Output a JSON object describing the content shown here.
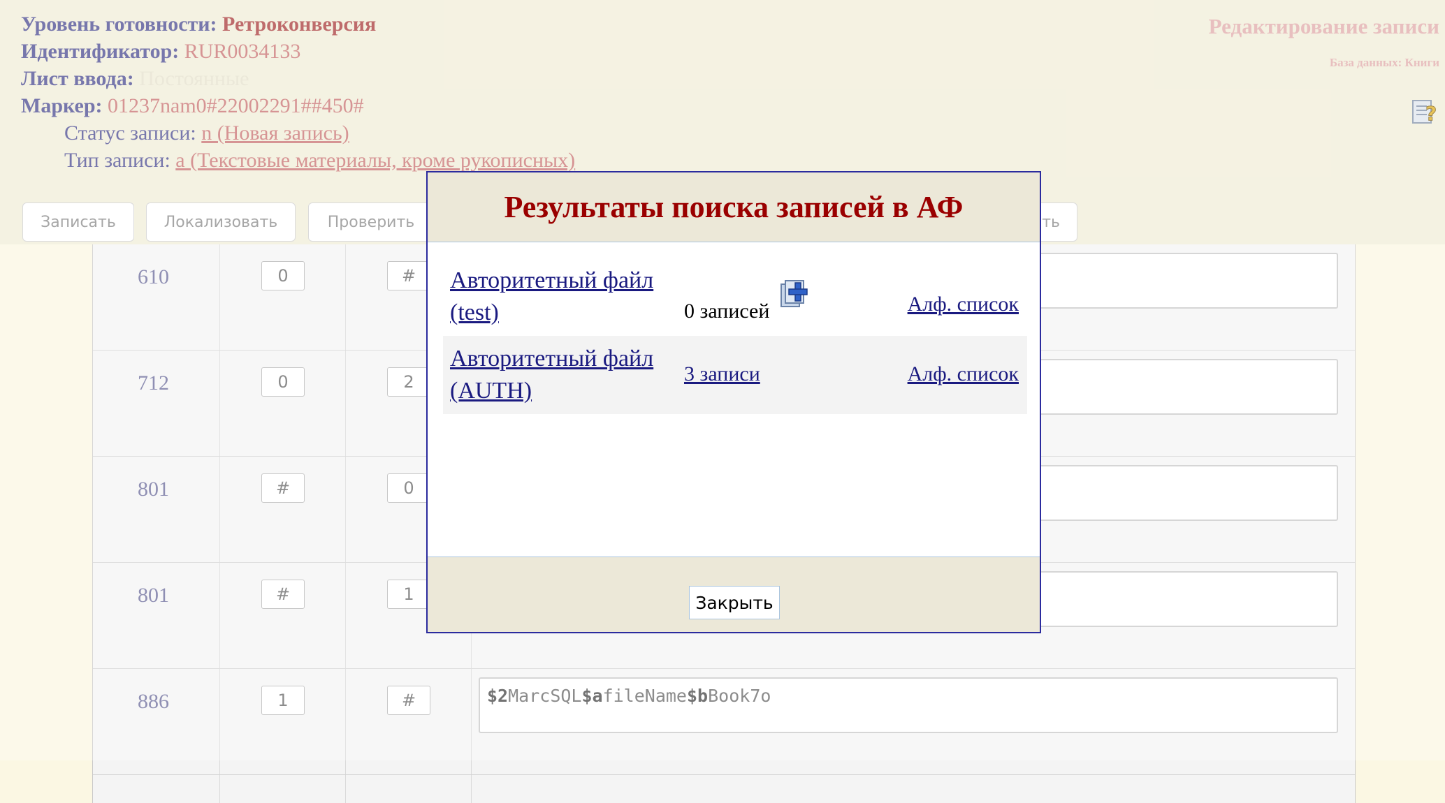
{
  "header": {
    "readiness_label": "Уровень готовности:",
    "readiness_value": "Ретроконверсия",
    "id_label": "Идентификатор:",
    "id_value": "RUR0034133",
    "sheet_label": "Лист ввода:",
    "sheet_value": "Постоянные",
    "marker_label": "Маркер:",
    "marker_value": "01237nam0#22002291##450#",
    "status_label": "Статус записи:",
    "status_value": "n (Новая запись)",
    "type_label": "Тип записи:",
    "type_value": "a (Текстовые материалы, кроме рукописных)",
    "page_title": "Редактирование записи",
    "database": "База данных: Книги"
  },
  "toolbar": {
    "save": "Записать",
    "localize": "Локализовать",
    "check": "Проверить",
    "partial": "ть"
  },
  "table_rows": [
    {
      "tag": "610",
      "ind1": "0",
      "ind2": "#"
    },
    {
      "tag": "712",
      "ind1": "0",
      "ind2": "2"
    },
    {
      "tag": "801",
      "ind1": "#",
      "ind2": "0"
    },
    {
      "tag": "801",
      "ind1": "#",
      "ind2": "1"
    },
    {
      "tag": "886",
      "ind1": "1",
      "ind2": "#",
      "value": [
        {
          "code": "$2",
          "text": "MarcSQL"
        },
        {
          "code": "$a",
          "text": "fileName"
        },
        {
          "code": "$b",
          "text": "Book7o"
        }
      ]
    }
  ],
  "modal": {
    "title": "Результаты поиска записей в АФ",
    "results": [
      {
        "name": "Авторитетный файл (test)",
        "count": "0 записей",
        "alf": "Алф. список"
      },
      {
        "name": "Авторитетный файл (AUTH)",
        "count": "3 записи",
        "alf": "Алф. список"
      }
    ],
    "close": "Закрыть"
  }
}
